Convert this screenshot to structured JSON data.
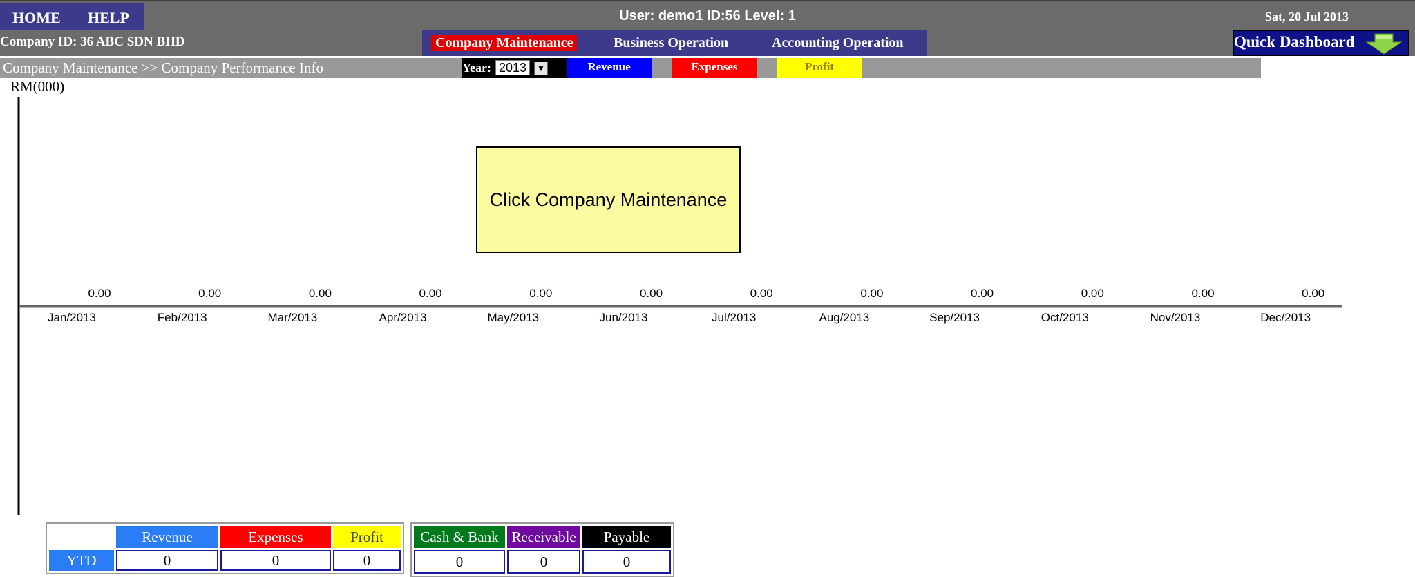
{
  "nav": {
    "home": "HOME",
    "help": "HELP"
  },
  "header": {
    "user_info": "User: demo1 ID:56 Level: 1",
    "date": "Sat, 20 Jul 2013"
  },
  "company": {
    "label": "Company ID: 36 ABC SDN BHD"
  },
  "menu": {
    "company_maintenance": "Company Maintenance",
    "business_operation": "Business Operation",
    "accounting_operation": "Accounting Operation"
  },
  "quick_dashboard": {
    "label": "Quick Dashboard",
    "icon": "arrow-down-icon"
  },
  "breadcrumb": "Company Maintenance >> Company Performance Info",
  "year": {
    "label": "Year:",
    "value": "2013"
  },
  "legend": [
    {
      "label": "Revenue",
      "color": "#0000ff",
      "text_color": "#ffffff"
    },
    {
      "label": "Expenses",
      "color": "#ff0000",
      "text_color": "#ffffff"
    },
    {
      "label": "Profit",
      "color": "#ffff00",
      "text_color": "#a08000"
    }
  ],
  "hint": "Click Company Maintenance",
  "chart_data": {
    "type": "bar",
    "ylabel": "RM(000)",
    "categories": [
      "Jan/2013",
      "Feb/2013",
      "Mar/2013",
      "Apr/2013",
      "May/2013",
      "Jun/2013",
      "Jul/2013",
      "Aug/2013",
      "Sep/2013",
      "Oct/2013",
      "Nov/2013",
      "Dec/2013"
    ],
    "value_labels": [
      "0.00",
      "0.00",
      "0.00",
      "0.00",
      "0.00",
      "0.00",
      "0.00",
      "0.00",
      "0.00",
      "0.00",
      "0.00",
      "0.00"
    ],
    "values": [
      0,
      0,
      0,
      0,
      0,
      0,
      0,
      0,
      0,
      0,
      0,
      0
    ]
  },
  "ytd_table": {
    "row_label": "YTD",
    "headers": [
      {
        "label": "Revenue",
        "color": "#2a7df5"
      },
      {
        "label": "Expenses",
        "color": "#ff0000"
      },
      {
        "label": "Profit",
        "color": "#ffff00"
      }
    ],
    "values": [
      "0",
      "0",
      "0"
    ]
  },
  "cash_table": {
    "headers": [
      {
        "label": "Cash & Bank",
        "color": "#007a1a"
      },
      {
        "label": "Receivable",
        "color": "#6e0b9e"
      },
      {
        "label": "Payable",
        "color": "#000000"
      }
    ],
    "values": [
      "0",
      "0",
      "0"
    ]
  }
}
